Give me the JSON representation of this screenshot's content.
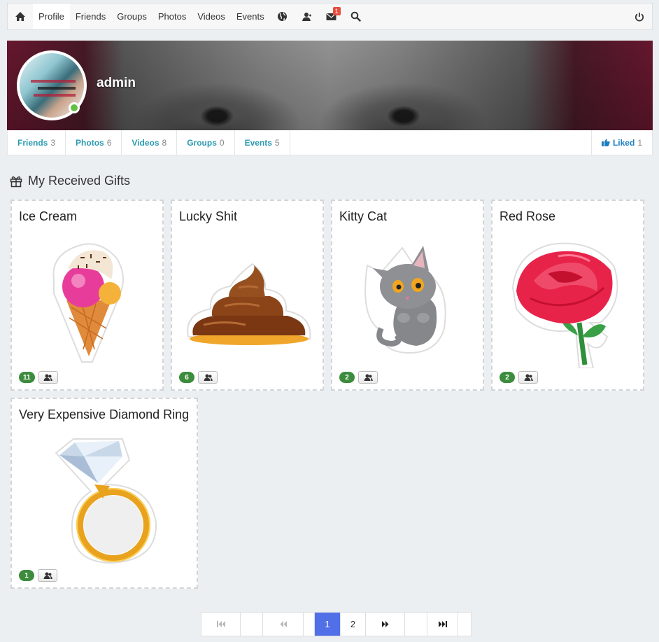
{
  "nav": {
    "links": [
      {
        "label": "Profile",
        "active": true
      },
      {
        "label": "Friends"
      },
      {
        "label": "Groups"
      },
      {
        "label": "Photos"
      },
      {
        "label": "Videos"
      },
      {
        "label": "Events"
      }
    ],
    "icons": [
      "home-icon",
      "globe-icon",
      "friend-requests-icon",
      "messages-icon",
      "search-icon",
      "power-icon"
    ],
    "messages_badge": "1"
  },
  "profile": {
    "username": "admin",
    "status": "online",
    "tabs": [
      {
        "label": "Friends",
        "count": "3"
      },
      {
        "label": "Photos",
        "count": "6"
      },
      {
        "label": "Videos",
        "count": "8"
      },
      {
        "label": "Groups",
        "count": "0"
      },
      {
        "label": "Events",
        "count": "5"
      }
    ],
    "liked": {
      "label": "Liked",
      "count": "1"
    }
  },
  "section": {
    "title": "My Received Gifts",
    "icon": "gift-icon"
  },
  "gifts": [
    {
      "name": "Ice Cream",
      "count": "11",
      "image": "ice-cream"
    },
    {
      "name": "Lucky Shit",
      "count": "6",
      "image": "poop"
    },
    {
      "name": "Kitty Cat",
      "count": "2",
      "image": "kitty-cat"
    },
    {
      "name": "Red Rose",
      "count": "2",
      "image": "red-rose"
    },
    {
      "name": "Very Expensive Diamond Ring",
      "count": "1",
      "image": "diamond-ring"
    }
  ],
  "pagination": {
    "pages": [
      "1",
      "2"
    ],
    "current": "1",
    "controls": [
      "first",
      "previous",
      "next",
      "last"
    ]
  },
  "colors": {
    "accent": "#2b9ab0",
    "count_badge": "#3d8b3d",
    "pager_active": "#5170e8",
    "online": "#64c045",
    "notify": "#e74c3c"
  }
}
